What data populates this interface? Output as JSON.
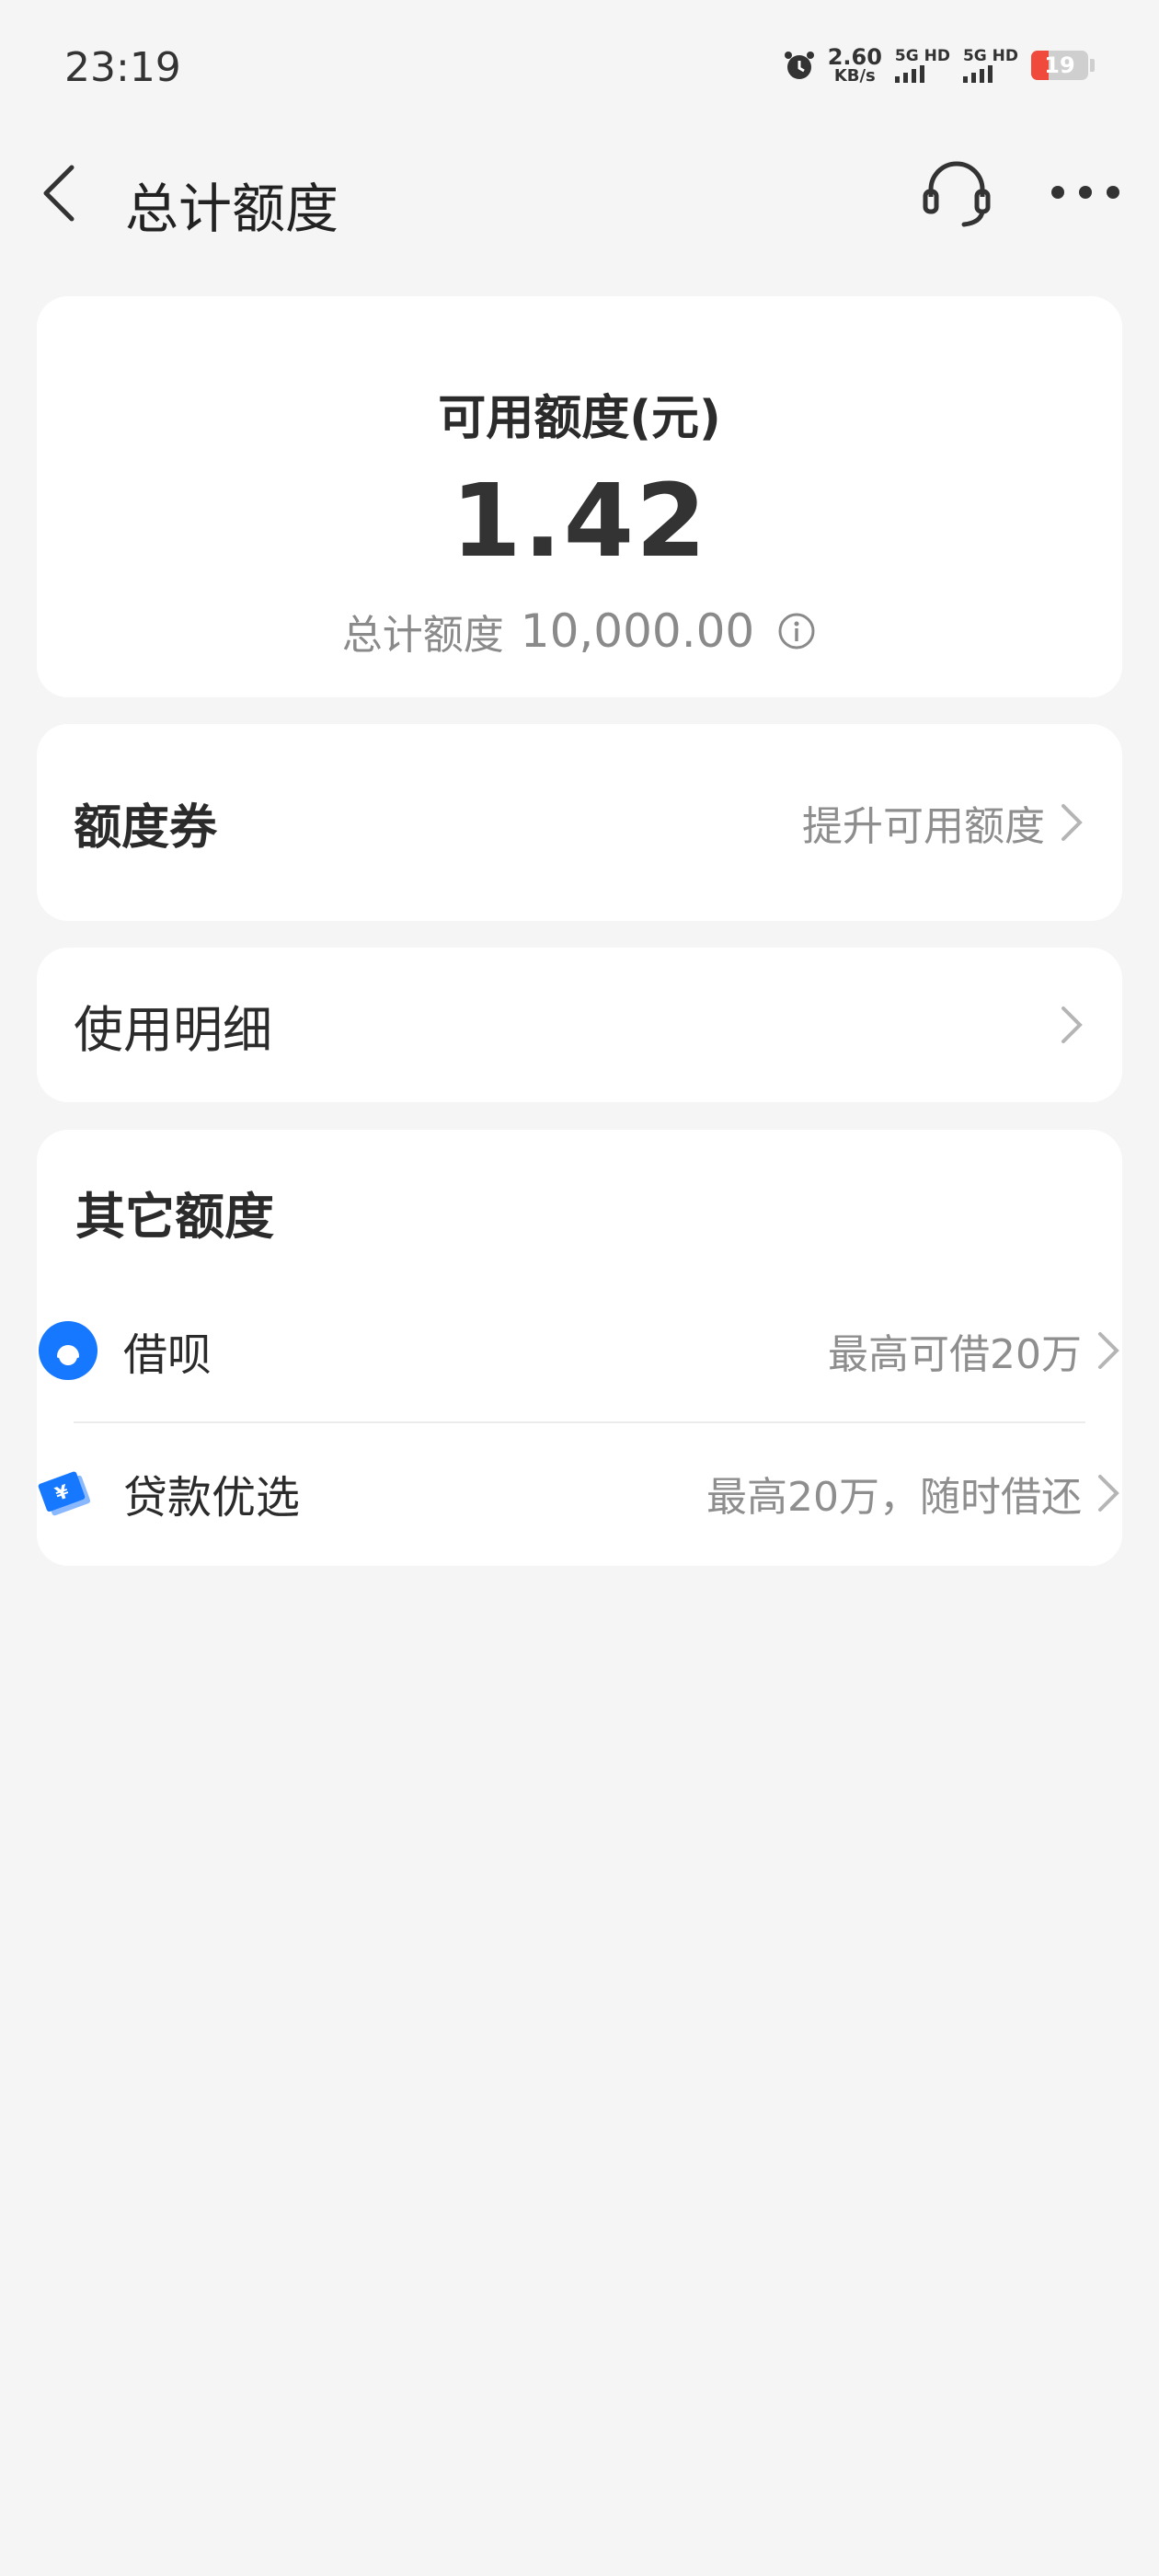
{
  "status_bar": {
    "time": "23:19",
    "net_speed_value": "2.60",
    "net_speed_unit": "KB/s",
    "sim1_label": "5G HD",
    "sim2_label": "5G HD",
    "battery_level": "19",
    "battery_color": "#f04a3c"
  },
  "nav": {
    "title": "总计额度",
    "back_icon": "chevron-left-icon",
    "service_icon": "headset-icon",
    "more_icon": "more-dots-icon"
  },
  "quota": {
    "label": "可用额度(元)",
    "available": "1.42",
    "total_label": "总计额度",
    "total_value": "10,000.00"
  },
  "coupon": {
    "title": "额度券",
    "hint": "提升可用额度"
  },
  "detail": {
    "title": "使用明细"
  },
  "other": {
    "title": "其它额度",
    "items": [
      {
        "label": "借呗",
        "hint": "最高可借20万",
        "icon": "jiebei-icon",
        "color": "#1677ff"
      },
      {
        "label": "贷款优选",
        "hint": "最高20万，随时借还",
        "icon": "loan-icon",
        "color": "#1677ff"
      }
    ]
  }
}
